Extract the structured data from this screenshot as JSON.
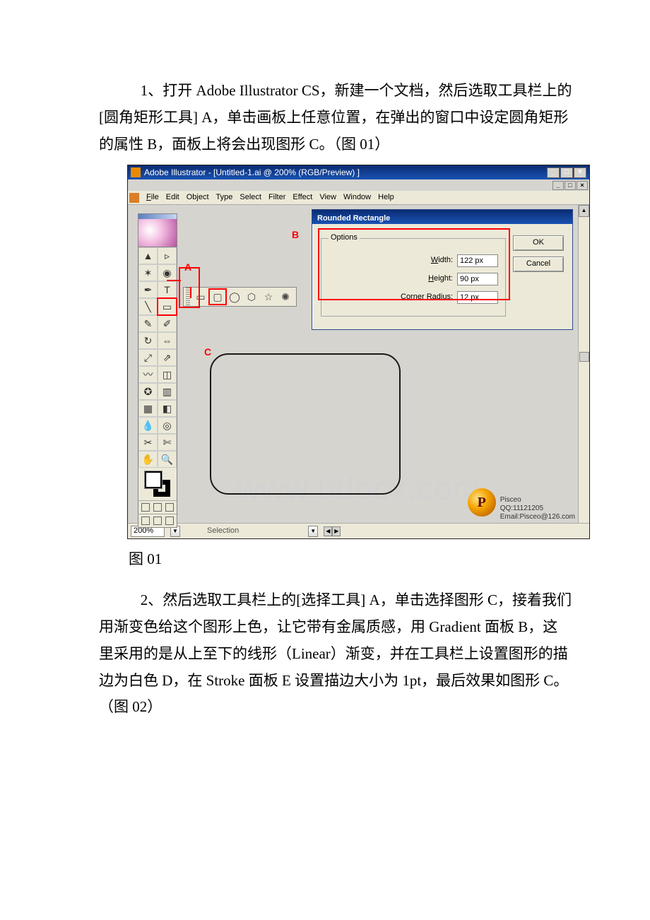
{
  "paragraphs": {
    "p1": "1、打开 Adobe Illustrator CS，新建一个文档，然后选取工具栏上的[圆角矩形工具] A，单击画板上任意位置，在弹出的窗口中设定圆角矩形的属性 B，面板上将会出现图形 C。（图 01）",
    "caption1": "图 01",
    "p2": "2、然后选取工具栏上的[选择工具] A，单击选择图形 C，接着我们用渐变色给这个图形上色，让它带有金属质感，用 Gradient 面板 B，这里采用的是从上至下的线形（Linear）渐变，并在工具栏上设置图形的描边为白色 D，在 Stroke 面板 E 设置描边大小为 1pt，最后效果如图形 C。（图 02）"
  },
  "screenshot": {
    "titlebar": "Adobe Illustrator - [Untitled-1.ai @ 200% (RGB/Preview) ]",
    "win_min": "_",
    "win_max": "□",
    "win_close": "×",
    "menu": {
      "file": "File",
      "edit": "Edit",
      "object": "Object",
      "type": "Type",
      "select": "Select",
      "filter": "Filter",
      "effect": "Effect",
      "view": "View",
      "window": "Window",
      "help": "Help"
    },
    "annotations": {
      "A": "A",
      "B": "B",
      "C": "C"
    },
    "dialog": {
      "title": "Rounded Rectangle",
      "options_legend": "Options",
      "width_label": "Width:",
      "width_value": "122 px",
      "height_label": "Height:",
      "height_value": "90 px",
      "radius_label": "Corner Radius:",
      "radius_value": "12 px",
      "ok": "OK",
      "cancel": "Cancel"
    },
    "status": {
      "zoom": "200%",
      "mode": "Selection"
    },
    "signature": {
      "name": "Pisceo",
      "qq": "QQ:11121205",
      "email": "Email:Pisceo@126.com"
    }
  },
  "watermark": "www.bdocx.com"
}
